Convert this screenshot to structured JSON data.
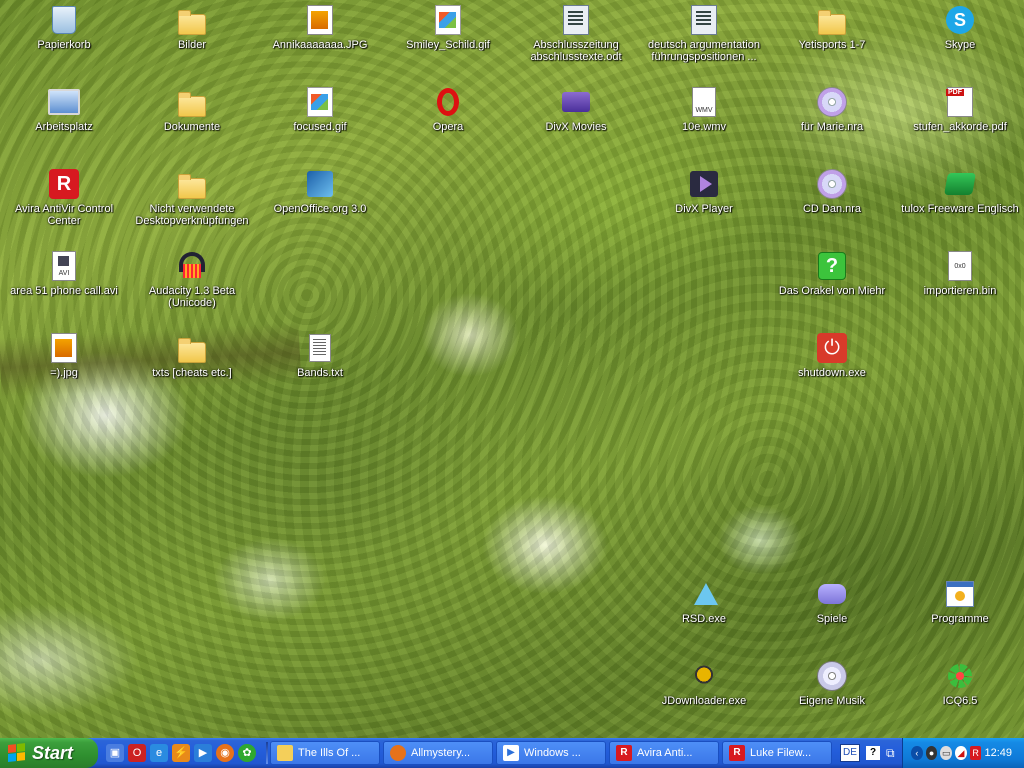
{
  "desktop": {
    "icons": [
      {
        "label": "Papierkorb",
        "icon": "recycle-bin-icon"
      },
      {
        "label": "Bilder",
        "icon": "folder-icon"
      },
      {
        "label": "Annikaaaaaaa.JPG",
        "icon": "image-file-icon"
      },
      {
        "label": "Smiley_Schild.gif",
        "icon": "image-file-icon"
      },
      {
        "label": "Abschlusszeitung abschlusstexte.odt",
        "icon": "odt-document-icon"
      },
      {
        "label": "deutsch argumentation führungspositionen ...",
        "icon": "odt-document-icon"
      },
      {
        "label": "Yetisports 1-7",
        "icon": "folder-icon"
      },
      {
        "label": "Skype",
        "icon": "skype-icon"
      },
      {
        "label": "Arbeitsplatz",
        "icon": "my-computer-icon"
      },
      {
        "label": "Dokumente",
        "icon": "folder-icon"
      },
      {
        "label": "focused.gif",
        "icon": "image-file-icon"
      },
      {
        "label": "Opera",
        "icon": "opera-icon"
      },
      {
        "label": "DivX Movies",
        "icon": "divx-movies-icon"
      },
      {
        "label": "10e.wmv",
        "icon": "wmv-video-icon"
      },
      {
        "label": "für Marie.nra",
        "icon": "cd-image-icon"
      },
      {
        "label": "stufen_akkorde.pdf",
        "icon": "pdf-icon"
      },
      {
        "label": "Avira AntiVir Control Center",
        "icon": "avira-icon"
      },
      {
        "label": "Nicht verwendete Desktopverknüpfungen",
        "icon": "folder-icon"
      },
      {
        "label": "OpenOffice.org 3.0",
        "icon": "openoffice-icon"
      },
      {
        "label": "DivX Player",
        "icon": "divx-player-icon"
      },
      {
        "label": "CD Dan.nra",
        "icon": "cd-image-icon"
      },
      {
        "label": "tulox Freeware Englisch",
        "icon": "tulox-icon"
      },
      {
        "label": "area 51 phone call.avi",
        "icon": "avi-video-icon"
      },
      {
        "label": "Audacity 1.3 Beta (Unicode)",
        "icon": "audacity-icon"
      },
      {
        "label": "Das Orakel von Miehr",
        "icon": "question-mark-icon"
      },
      {
        "label": "importieren.bin",
        "icon": "bin-file-icon"
      },
      {
        "label": "=).jpg",
        "icon": "jpg-file-icon"
      },
      {
        "label": "txts [cheats etc.]",
        "icon": "folder-icon"
      },
      {
        "label": "Bands.txt",
        "icon": "text-file-icon"
      },
      {
        "label": "shutdown.exe",
        "icon": "power-icon"
      },
      {
        "label": "RSD.exe",
        "icon": "rsd-icon"
      },
      {
        "label": "Spiele",
        "icon": "games-icon"
      },
      {
        "label": "Programme",
        "icon": "programs-icon"
      },
      {
        "label": "JDownloader.exe",
        "icon": "jdownloader-icon"
      },
      {
        "label": "Eigene Musik",
        "icon": "music-cd-icon"
      },
      {
        "label": "ICQ6.5",
        "icon": "icq-icon"
      }
    ]
  },
  "taskbar": {
    "start_label": "Start",
    "tasks": [
      {
        "label": "The Ills Of ...",
        "icon": "folder-icon"
      },
      {
        "label": "Allmystery...",
        "icon": "firefox-icon"
      },
      {
        "label": "Windows ...",
        "icon": "media-player-icon"
      },
      {
        "label": "Avira Anti...",
        "icon": "avira-icon"
      },
      {
        "label": "Luke Filew...",
        "icon": "avira-icon"
      }
    ],
    "language": "DE",
    "clock": "12:49"
  },
  "colors": {
    "taskbar_blue": "#245edb",
    "start_green": "#3c9f3c",
    "tray_blue": "#0f7ad8"
  }
}
